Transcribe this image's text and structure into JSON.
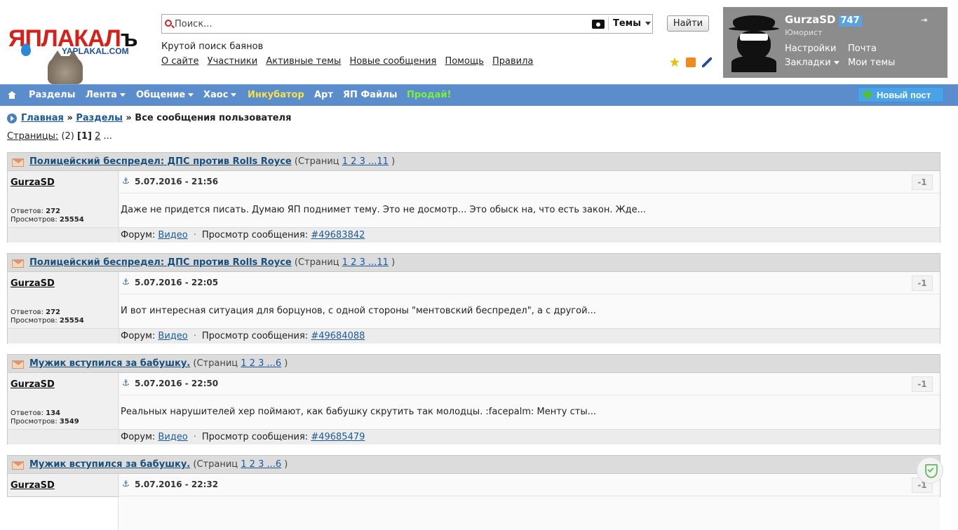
{
  "logo": {
    "main": "ЯПЛАКАЛ",
    "suffix": "ъ",
    "sub": "YAPLAKAL.COM"
  },
  "search": {
    "placeholder": "Поиск...",
    "scope": "Темы",
    "button": "Найти"
  },
  "tagline": "Крутой поиск баянов",
  "topnav": [
    "О сайте",
    "Участники",
    "Активные темы",
    "Новые сообщения",
    "Помощь",
    "Правила"
  ],
  "tool_icons": [
    "star-icon",
    "rss-icon",
    "pen-icon"
  ],
  "user": {
    "name": "GurzaSD",
    "count": "747",
    "rank": "Юморист",
    "links": {
      "settings": "Настройки",
      "mail": "Почта",
      "bookmarks": "Закладки",
      "my_topics": "Мои темы"
    }
  },
  "menu": {
    "items": [
      {
        "label": "Разделы"
      },
      {
        "label": "Лента"
      },
      {
        "label": "Общение"
      },
      {
        "label": "Хаос"
      },
      {
        "label": "Инкубатор"
      },
      {
        "label": "Арт"
      },
      {
        "label": "ЯП Файлы"
      },
      {
        "label": "Продай!"
      }
    ],
    "new_post": "Новый пост",
    "colors": {
      "incubator": "#f5e14a",
      "sell": "#7cf03a",
      "bar": "#5b8ccc"
    }
  },
  "breadcrumb": {
    "home": "Главная",
    "sep": "»",
    "sections": "Разделы",
    "current": "Все сообщения пользователя"
  },
  "pager": {
    "label": "Страницы:",
    "count": "(2)",
    "current": "[1]",
    "next": "2",
    "more": "..."
  },
  "posts": [
    {
      "title": "Полицейский беспредел: ДПС против Rolls Royce",
      "pages_prefix": "(Страниц",
      "pages": "1 2 3 ...11",
      "pages_suffix": ")",
      "author": "GurzaSD",
      "replies_label": "Ответов:",
      "replies": "272",
      "views_label": "Просмотров:",
      "views": "25554",
      "date": "5.07.2016 - 21:56",
      "rating": "-1",
      "text": "Даже не придется писать. Думаю ЯП поднимет тему. Это не досмотр... Это обыск на, что есть закон. Жде...",
      "forum_label": "Форум:",
      "forum": "Видео",
      "dot": "·",
      "view_label": "Просмотр сообщения:",
      "msg_id": "#49683842"
    },
    {
      "title": "Полицейский беспредел: ДПС против Rolls Royce",
      "pages_prefix": "(Страниц",
      "pages": "1 2 3 ...11",
      "pages_suffix": ")",
      "author": "GurzaSD",
      "replies_label": "Ответов:",
      "replies": "272",
      "views_label": "Просмотров:",
      "views": "25554",
      "date": "5.07.2016 - 22:05",
      "rating": "-1",
      "text": "И вот интересная ситуация для борцунов, с одной стороны \"ментовский беспредел\", а с другой...",
      "forum_label": "Форум:",
      "forum": "Видео",
      "dot": "·",
      "view_label": "Просмотр сообщения:",
      "msg_id": "#49684088"
    },
    {
      "title": "Мужик вступился за бабушку.",
      "pages_prefix": "(Страниц",
      "pages": "1 2 3 ...6",
      "pages_suffix": ")",
      "author": "GurzaSD",
      "replies_label": "Ответов:",
      "replies": "134",
      "views_label": "Просмотров:",
      "views": "3549",
      "date": "5.07.2016 - 22:50",
      "rating": "-1",
      "text": "Реальных  нарушителей хер поймают, как бабушку скрутить так молодцы.  :facepalm: Менту сты...",
      "forum_label": "Форум:",
      "forum": "Видео",
      "dot": "·",
      "view_label": "Просмотр сообщения:",
      "msg_id": "#49685479"
    },
    {
      "title": "Мужик вступился за бабушку.",
      "pages_prefix": "(Страниц",
      "pages": "1 2 3 ...6",
      "pages_suffix": ")",
      "author": "GurzaSD",
      "date": "5.07.2016 - 22:32",
      "rating": "-1"
    }
  ]
}
